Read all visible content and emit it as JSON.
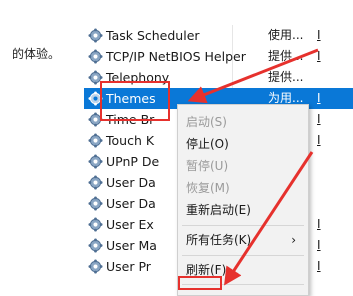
{
  "left_pane": {
    "text": "的体验。"
  },
  "services": [
    {
      "name": "Task Scheduler",
      "status": "使用...",
      "mark": "I",
      "selected": false
    },
    {
      "name": "TCP/IP NetBIOS Helper",
      "status": "提供...",
      "mark": "I",
      "selected": false
    },
    {
      "name": "Telephony",
      "status": "提供...",
      "mark": "",
      "selected": false
    },
    {
      "name": "Themes",
      "status": "为用...",
      "mark": "I",
      "selected": true
    },
    {
      "name": "Time Br",
      "status": "",
      "mark": "I",
      "selected": false
    },
    {
      "name": "Touch K",
      "status": "",
      "mark": "I",
      "selected": false
    },
    {
      "name": "UPnP De",
      "status": "",
      "mark": "",
      "selected": false
    },
    {
      "name": "User Da",
      "status": "",
      "mark": "",
      "selected": false
    },
    {
      "name": "User Da",
      "status": "",
      "mark": "",
      "selected": false
    },
    {
      "name": "User Ex",
      "status": "",
      "mark": "I",
      "selected": false
    },
    {
      "name": "User Ma",
      "status": "",
      "mark": "I",
      "selected": false
    },
    {
      "name": "User Pr",
      "status": "",
      "mark": "I",
      "selected": false
    }
  ],
  "context_menu": {
    "start": "启动(S)",
    "stop": "停止(O)",
    "pause": "暂停(U)",
    "resume": "恢复(M)",
    "restart": "重新启动(E)",
    "all_tasks": "所有任务(K)",
    "all_tasks_arrow": "›",
    "refresh": "刷新(F)"
  },
  "colors": {
    "selection": "#0a78d7",
    "annotation": "#e6312d",
    "menu_background": "#f2f2f2",
    "disabled_text": "#9a9a9a"
  },
  "icons": {
    "service": "gear-icon",
    "submenu": "chevron-right-icon"
  }
}
